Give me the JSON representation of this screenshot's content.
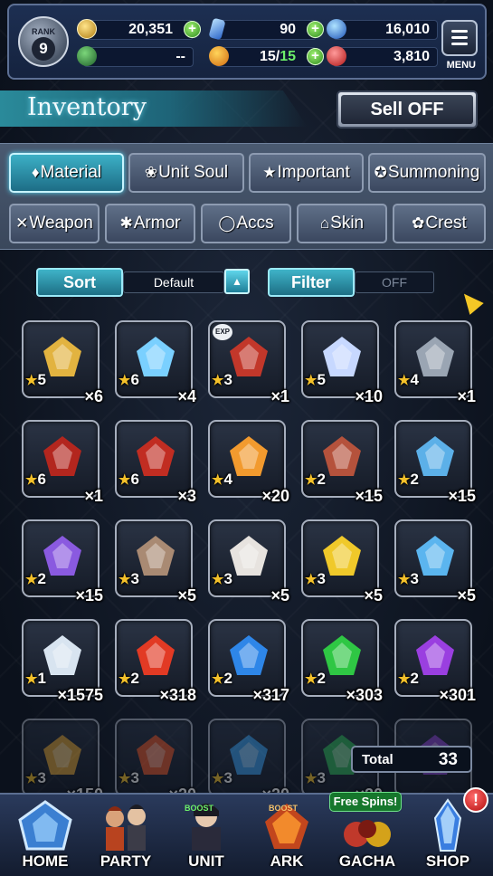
{
  "status": {
    "rank_label": "RANK",
    "rank_value": "9",
    "gil": "20,351",
    "lapis": "90",
    "visiore": "16,010",
    "second_left": "--",
    "stamina": "15",
    "stamina_max": "15",
    "second_right": "3,810",
    "menu_label": "MENU"
  },
  "header": {
    "title": "Inventory",
    "sell_label": "Sell OFF"
  },
  "tabs": [
    {
      "label": "Material",
      "icon": "bag-icon"
    },
    {
      "label": "Unit Soul",
      "icon": "soul-icon"
    },
    {
      "label": "Important",
      "icon": "star-icon"
    },
    {
      "label": "Summoning",
      "icon": "summon-icon"
    },
    {
      "label": "Weapon",
      "icon": "sword-icon"
    },
    {
      "label": "Armor",
      "icon": "armor-icon"
    },
    {
      "label": "Accs",
      "icon": "ring-icon"
    },
    {
      "label": "Skin",
      "icon": "hanger-icon"
    },
    {
      "label": "Crest",
      "icon": "crest-icon"
    }
  ],
  "sort": {
    "label": "Sort",
    "value": "Default"
  },
  "filter": {
    "label": "Filter",
    "value": "OFF"
  },
  "items": [
    {
      "name": "gold-ingots",
      "tag": "",
      "stars": "5",
      "qty": "×6",
      "color": "#e2b340"
    },
    {
      "name": "rainbow-orb",
      "tag": "",
      "stars": "6",
      "qty": "×4",
      "color": "#7ad0ff"
    },
    {
      "name": "red-potion",
      "tag": "EXP",
      "stars": "3",
      "qty": "×1",
      "color": "#c2372a"
    },
    {
      "name": "prism-crystal",
      "tag": "",
      "stars": "5",
      "qty": "×10",
      "color": "#c7d8ff"
    },
    {
      "name": "silver-ore",
      "tag": "",
      "stars": "4",
      "qty": "×1",
      "color": "#9aa5b3"
    },
    {
      "name": "red-beast-portrait",
      "tag": "",
      "stars": "6",
      "qty": "×1",
      "color": "#b3261e"
    },
    {
      "name": "red-warrior-portrait",
      "tag": "",
      "stars": "6",
      "qty": "×3",
      "color": "#c12d22"
    },
    {
      "name": "fire-elixir",
      "tag": "",
      "stars": "4",
      "qty": "×20",
      "color": "#f29a2e"
    },
    {
      "name": "meat",
      "tag": "",
      "stars": "2",
      "qty": "×15",
      "color": "#b5523c"
    },
    {
      "name": "blue-potion",
      "tag": "",
      "stars": "2",
      "qty": "×15",
      "color": "#5cb0e8"
    },
    {
      "name": "purple-crystals",
      "tag": "",
      "stars": "2",
      "qty": "×15",
      "color": "#8a5ae0"
    },
    {
      "name": "horn",
      "tag": "",
      "stars": "3",
      "qty": "×5",
      "color": "#a98a73"
    },
    {
      "name": "letter",
      "tag": "",
      "stars": "3",
      "qty": "×5",
      "color": "#e7e3df"
    },
    {
      "name": "golden-apple",
      "tag": "",
      "stars": "3",
      "qty": "×5",
      "color": "#f0c92a"
    },
    {
      "name": "blue-bone",
      "tag": "",
      "stars": "3",
      "qty": "×5",
      "color": "#5bb5ef"
    },
    {
      "name": "white-gem",
      "tag": "",
      "stars": "1",
      "qty": "×1575",
      "color": "#d8e4f0"
    },
    {
      "name": "red-gem",
      "tag": "",
      "stars": "2",
      "qty": "×318",
      "color": "#e23a24"
    },
    {
      "name": "blue-gem",
      "tag": "",
      "stars": "2",
      "qty": "×317",
      "color": "#2e86e8"
    },
    {
      "name": "green-gem",
      "tag": "",
      "stars": "2",
      "qty": "×303",
      "color": "#2fc744"
    },
    {
      "name": "violet-gem",
      "tag": "",
      "stars": "2",
      "qty": "×301",
      "color": "#9a3fe0"
    },
    {
      "name": "rainbow-gem",
      "tag": "",
      "stars": "3",
      "qty": "×150",
      "color": "#d9a13a"
    },
    {
      "name": "orange-gem",
      "tag": "",
      "stars": "3",
      "qty": "×20",
      "color": "#e0562c"
    },
    {
      "name": "cyan-gem",
      "tag": "",
      "stars": "3",
      "qty": "×20",
      "color": "#3a9be6"
    },
    {
      "name": "green-gem-2",
      "tag": "",
      "stars": "3",
      "qty": "×20",
      "color": "#32b35a"
    },
    {
      "name": "purple-gem-2",
      "tag": "",
      "stars": "",
      "qty": "",
      "color": "#8a4ad0"
    }
  ],
  "total": {
    "label": "Total",
    "value": "33"
  },
  "nav": [
    {
      "label": "HOME",
      "icon": "home-icon"
    },
    {
      "label": "PARTY",
      "icon": "party-icon"
    },
    {
      "label": "UNIT",
      "icon": "unit-icon"
    },
    {
      "label": "ARK",
      "icon": "ark-icon"
    },
    {
      "label": "GACHA",
      "icon": "gacha-icon"
    },
    {
      "label": "SHOP",
      "icon": "shop-icon"
    }
  ],
  "free_spins": "Free Spins!",
  "shop_badge": "!"
}
